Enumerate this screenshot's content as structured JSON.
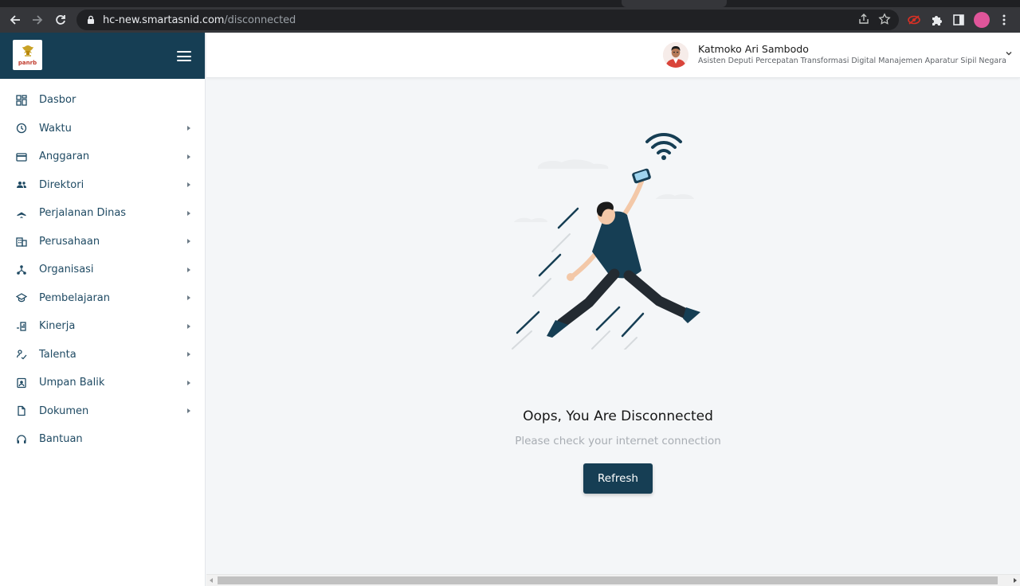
{
  "browser": {
    "url_host": "hc-new.smartasnid.com",
    "url_path": "/disconnected",
    "accent_profile": "#e0559a"
  },
  "sidebar": {
    "logo_text": "panrb",
    "items": [
      {
        "label": "Dasbor",
        "icon": "dashboard-icon",
        "submenu": false
      },
      {
        "label": "Waktu",
        "icon": "clock-icon",
        "submenu": true
      },
      {
        "label": "Anggaran",
        "icon": "card-icon",
        "submenu": true
      },
      {
        "label": "Direktori",
        "icon": "people-icon",
        "submenu": true
      },
      {
        "label": "Perjalanan Dinas",
        "icon": "airplane-icon",
        "submenu": true
      },
      {
        "label": "Perusahaan",
        "icon": "building-icon",
        "submenu": true
      },
      {
        "label": "Organisasi",
        "icon": "org-icon",
        "submenu": true
      },
      {
        "label": "Pembelajaran",
        "icon": "graduation-icon",
        "submenu": true
      },
      {
        "label": "Kinerja",
        "icon": "chart-icon",
        "submenu": true
      },
      {
        "label": "Talenta",
        "icon": "talent-icon",
        "submenu": true
      },
      {
        "label": "Umpan Balik",
        "icon": "feedback-icon",
        "submenu": true
      },
      {
        "label": "Dokumen",
        "icon": "document-icon",
        "submenu": true
      },
      {
        "label": "Bantuan",
        "icon": "headset-icon",
        "submenu": false
      }
    ]
  },
  "header": {
    "user_name": "Katmoko Ari Sambodo",
    "user_role": "Asisten Deputi Percepatan Transformasi Digital Manajemen Aparatur Sipil Negara"
  },
  "main": {
    "title": "Oops, You Are Disconnected",
    "subtitle": "Please check your internet connection",
    "refresh_label": "Refresh"
  },
  "colors": {
    "brand": "#163e54",
    "menu_text": "#1f4a63"
  }
}
